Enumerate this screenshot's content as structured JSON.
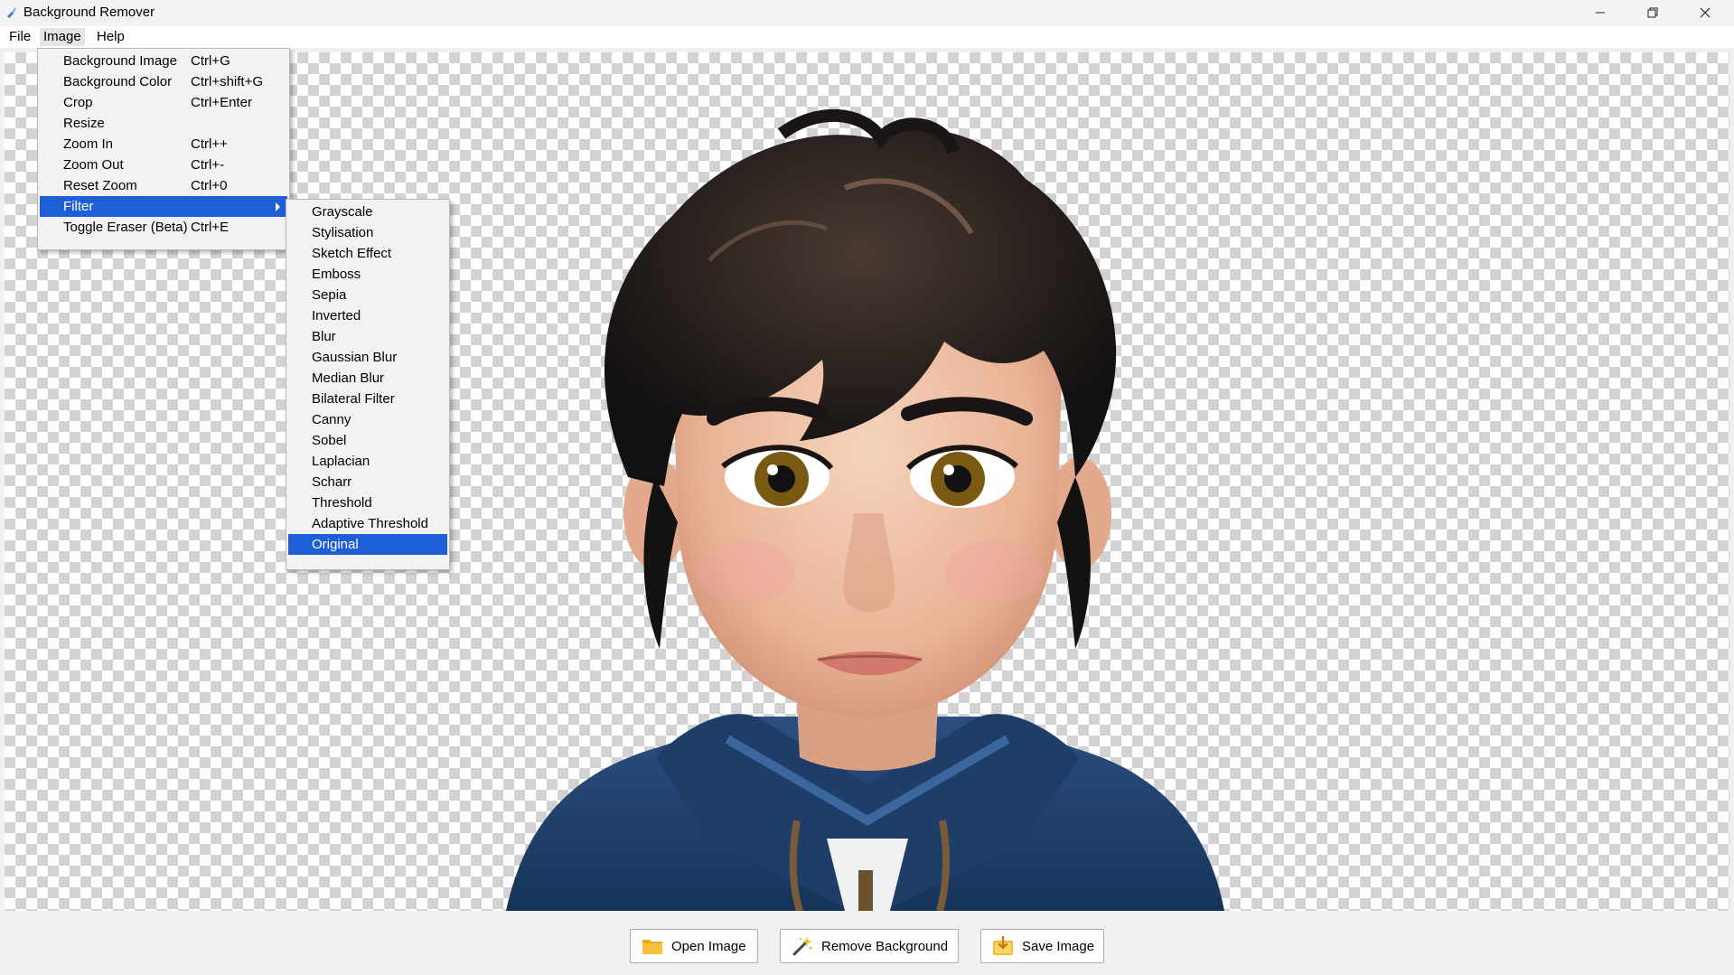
{
  "window": {
    "title": "Background Remover"
  },
  "menubar": [
    {
      "label": "File"
    },
    {
      "label": "Image"
    },
    {
      "label": "Help"
    }
  ],
  "image_menu": [
    {
      "label": "Background Image",
      "shortcut": "Ctrl+G"
    },
    {
      "label": "Background Color",
      "shortcut": "Ctrl+shift+G"
    },
    {
      "label": "Crop",
      "shortcut": "Ctrl+Enter"
    },
    {
      "label": "Resize",
      "shortcut": ""
    },
    {
      "label": "Zoom In",
      "shortcut": "Ctrl++"
    },
    {
      "label": "Zoom Out",
      "shortcut": "Ctrl+-"
    },
    {
      "label": "Reset Zoom",
      "shortcut": "Ctrl+0"
    },
    {
      "label": "Filter",
      "shortcut": "",
      "selected": true,
      "submenu": true
    },
    {
      "label": "Toggle Eraser (Beta)",
      "shortcut": "Ctrl+E"
    }
  ],
  "filter_menu": [
    {
      "label": "Grayscale"
    },
    {
      "label": "Stylisation"
    },
    {
      "label": "Sketch Effect"
    },
    {
      "label": "Emboss"
    },
    {
      "label": "Sepia"
    },
    {
      "label": "Inverted"
    },
    {
      "label": "Blur"
    },
    {
      "label": "Gaussian Blur"
    },
    {
      "label": "Median Blur"
    },
    {
      "label": "Bilateral Filter"
    },
    {
      "label": "Canny"
    },
    {
      "label": "Sobel"
    },
    {
      "label": "Laplacian"
    },
    {
      "label": "Scharr"
    },
    {
      "label": "Threshold"
    },
    {
      "label": "Adaptive Threshold"
    },
    {
      "label": "Original",
      "selected": true
    }
  ],
  "buttons": {
    "open": "Open Image",
    "remove": "Remove Background",
    "save": "Save Image"
  },
  "icons": {
    "app": "app-brush-icon",
    "open": "folder-icon",
    "remove": "magic-wand-icon",
    "save": "save-download-icon"
  },
  "colors": {
    "selection": "#1f5fd6",
    "checker_dark": "#d2d2d2",
    "checker_light": "#ffffff"
  }
}
